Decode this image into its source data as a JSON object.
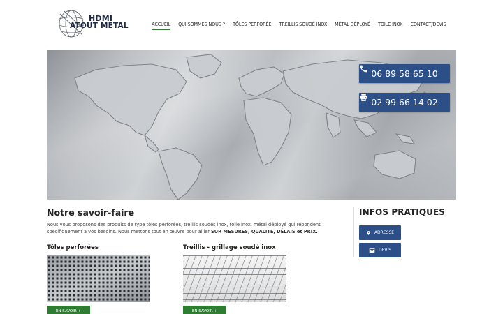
{
  "logo": {
    "line1": "HDMI",
    "line2": "ATOUT METAL"
  },
  "nav": {
    "items": [
      {
        "label": "ACCUEIL",
        "active": true
      },
      {
        "label": "QUI SOMMES NOUS ?"
      },
      {
        "label": "TÔLES PERFORÉE"
      },
      {
        "label": "TREILLIS SOUDÉ INOX"
      },
      {
        "label": "MÉTAL DÉPLOYÉ"
      },
      {
        "label": "TOILE INOX"
      },
      {
        "label": "CONTACT/DEVIS"
      }
    ]
  },
  "hero": {
    "phone": "06 89 58 65 10",
    "fax": "02 99 66 14 02"
  },
  "main": {
    "title": "Notre savoir-faire",
    "intro_text": "Nous vous proposons des produits de type tôles perforées, treillis soudés inox, toile inox, métal déployé qui répondent spécifiquement à vos besoins. Nous mettons tout en œuvre pour allier ",
    "intro_strong": "SUR MESURES, QUALITÉ, DÉLAIS et PRIX.",
    "products": [
      {
        "title": "Tôles perforées",
        "button": "EN SAVOIR +"
      },
      {
        "title": "Treillis - grillage soudé inox",
        "button": "EN SAVOIR +"
      }
    ]
  },
  "infos": {
    "title": "INFOS PRATIQUES",
    "adresse_label": "ADRESSE",
    "devis_label": "DEVIS"
  },
  "colors": {
    "green": "#2e7d32",
    "blue": "#2b4f86"
  },
  "icons": [
    "globe-logo-icon",
    "phone-icon",
    "printer-icon",
    "map-marker-icon",
    "envelope-icon"
  ]
}
